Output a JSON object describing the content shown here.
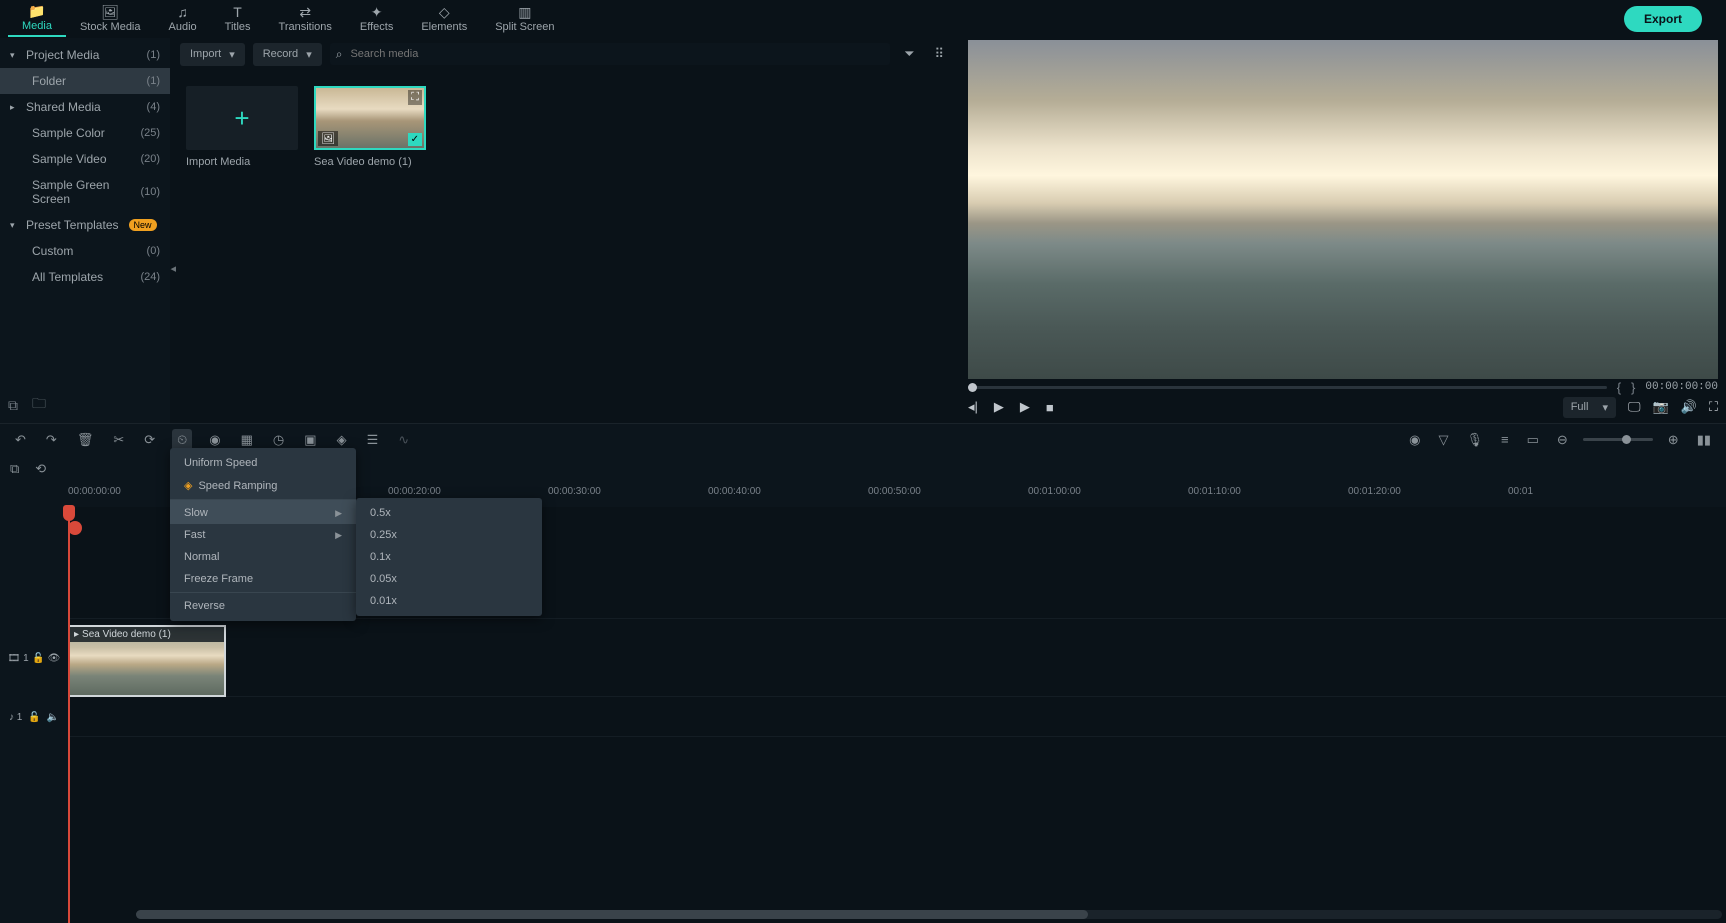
{
  "nav": {
    "tabs": [
      {
        "label": "Media",
        "icon": "📁",
        "active": true
      },
      {
        "label": "Stock Media",
        "icon": "🖼"
      },
      {
        "label": "Audio",
        "icon": "♫"
      },
      {
        "label": "Titles",
        "icon": "T"
      },
      {
        "label": "Transitions",
        "icon": "⇄"
      },
      {
        "label": "Effects",
        "icon": "✦"
      },
      {
        "label": "Elements",
        "icon": "◇"
      },
      {
        "label": "Split Screen",
        "icon": "▥"
      }
    ],
    "export": "Export"
  },
  "sidebar": {
    "items": [
      {
        "label": "Project Media",
        "count": "(1)",
        "chevron": "▾"
      },
      {
        "label": "Folder",
        "count": "(1)",
        "indent": true,
        "selected": true
      },
      {
        "label": "Shared Media",
        "count": "(4)",
        "chevron": "▸"
      },
      {
        "label": "Sample Color",
        "count": "(25)",
        "indent": true
      },
      {
        "label": "Sample Video",
        "count": "(20)",
        "indent": true
      },
      {
        "label": "Sample Green Screen",
        "count": "(10)",
        "indent": true
      },
      {
        "label": "Preset Templates",
        "count": "",
        "chevron": "▾",
        "badge": "New"
      },
      {
        "label": "Custom",
        "count": "(0)",
        "indent": true
      },
      {
        "label": "All Templates",
        "count": "(24)",
        "indent": true
      }
    ]
  },
  "media_toolbar": {
    "import": "Import",
    "record": "Record",
    "search_placeholder": "Search media"
  },
  "media_items": {
    "import_label": "Import Media",
    "clip1_label": "Sea Video demo (1)"
  },
  "preview": {
    "timecode": "00:00:00:00",
    "quality": "Full"
  },
  "timeline": {
    "ruler_labels": [
      "00:00:00:00",
      "00:00:20:00",
      "00:00:30:00",
      "00:00:40:00",
      "00:00:50:00",
      "00:01:00:00",
      "00:01:10:00",
      "00:01:20:00",
      "00:01"
    ],
    "clip_name": "Sea Video demo (1)",
    "track_video": "1",
    "track_audio": "1"
  },
  "context_menu": {
    "items": [
      {
        "label": "Uniform Speed"
      },
      {
        "label": "Speed Ramping",
        "icon": "◈"
      },
      {
        "label": "Slow",
        "arrow": true,
        "highlighted": true,
        "sep": true
      },
      {
        "label": "Fast",
        "arrow": true
      },
      {
        "label": "Normal"
      },
      {
        "label": "Freeze Frame"
      },
      {
        "label": "Reverse",
        "sep": true
      }
    ],
    "submenu": [
      "0.5x",
      "0.25x",
      "0.1x",
      "0.05x",
      "0.01x"
    ]
  }
}
